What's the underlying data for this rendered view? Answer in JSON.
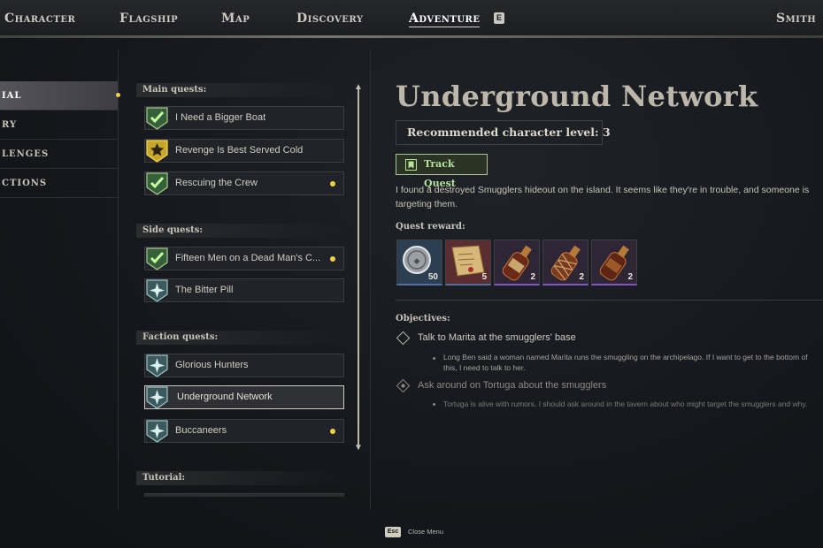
{
  "topnav": {
    "items": [
      "Character",
      "Flagship",
      "Map",
      "Discovery",
      "Adventure"
    ],
    "active": "Adventure",
    "key_hint": "E",
    "player_name": "Smith"
  },
  "categories": [
    {
      "label": "IAL",
      "active": true,
      "has_new": true
    },
    {
      "label": "RY",
      "active": false
    },
    {
      "label": "LENGES",
      "active": false
    },
    {
      "label": "CTIONS",
      "active": false
    }
  ],
  "quest_sections": {
    "main": {
      "label": "Main quests:",
      "quests": [
        {
          "label": "I Need a Bigger Boat",
          "status": "completed",
          "has_new": false
        },
        {
          "label": "Revenge Is Best Served Cold",
          "status": "main-active",
          "has_new": false
        },
        {
          "label": "Rescuing the Crew",
          "status": "completed",
          "has_new": true
        }
      ]
    },
    "side": {
      "label": "Side quests:",
      "quests": [
        {
          "label": "Fifteen Men on a Dead Man's C...",
          "status": "completed",
          "has_new": true
        },
        {
          "label": "The Bitter Pill",
          "status": "available",
          "has_new": false
        }
      ]
    },
    "faction": {
      "label": "Faction quests:",
      "quests": [
        {
          "label": "Glorious Hunters",
          "status": "available",
          "has_new": false
        },
        {
          "label": "Underground Network",
          "status": "available",
          "has_new": false,
          "selected": true
        },
        {
          "label": "Buccaneers",
          "status": "available",
          "has_new": true
        }
      ]
    },
    "tutorial": {
      "label": "Tutorial:"
    }
  },
  "detail": {
    "title": "Underground Network",
    "level_text": "Recommended character level: 3",
    "track_button": "Track Quest",
    "description": "I found a destroyed Smugglers hideout on the island. It seems like they're in trouble, and someone is targeting them.",
    "reward_label": "Quest reward:",
    "rewards": [
      {
        "icon": "silver-coin-icon",
        "count": "50",
        "rarity": "common"
      },
      {
        "icon": "map-scroll-icon",
        "count": "5",
        "rarity": "common"
      },
      {
        "icon": "bottle-icon",
        "count": "2",
        "rarity": "rare"
      },
      {
        "icon": "wrapped-bottle-icon",
        "count": "2",
        "rarity": "rare"
      },
      {
        "icon": "bottle-icon",
        "count": "2",
        "rarity": "rare"
      }
    ],
    "objectives_label": "Objectives:",
    "objectives": [
      {
        "title": "Talk to Marita at the smugglers' base",
        "desc": "Long Ben said a woman named Marita runs the smuggling on the archipelago. If I want to get to the bottom of this, I need to talk to her.",
        "dim": false
      },
      {
        "title": "Ask around on Tortuga about the smugglers",
        "desc": "Tortuga is alive with rumors. I should ask around in the tavern about who might target the smugglers and why.",
        "dim": true
      }
    ]
  },
  "footer": {
    "key": "Esc",
    "label": "Close Menu"
  },
  "colors": {
    "accent_yellow": "#f3d34a",
    "track_green": "#b6e39a",
    "rare_purple": "#8155c8"
  }
}
